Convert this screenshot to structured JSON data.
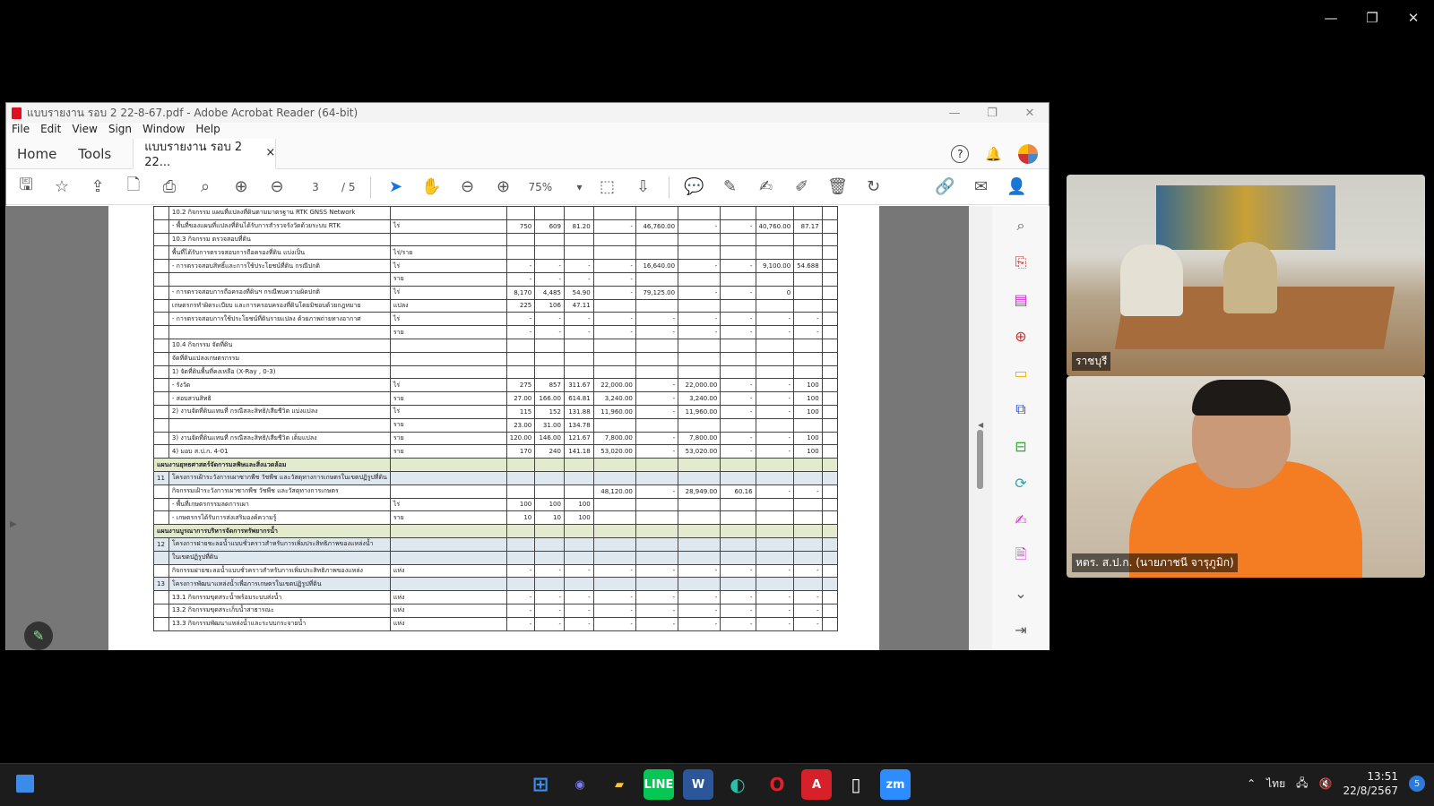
{
  "window": {
    "title": "แบบรายงาน รอบ 2 22-8-67.pdf - Adobe Acrobat Reader (64-bit)",
    "menu": [
      "File",
      "Edit",
      "View",
      "Sign",
      "Window",
      "Help"
    ],
    "tabs": {
      "home": "Home",
      "tools": "Tools",
      "doc": "แบบรายงาน รอบ 2 22...",
      "close": "×"
    }
  },
  "toolbar": {
    "page_current": "3",
    "page_total": "/ 5",
    "zoom": "75%"
  },
  "sheet": {
    "rows": [
      {
        "c0": "",
        "c1": "10.2  กิจกรรม แผนที่แปลงที่ดินตามมาตรฐาน RTK GNSS Network",
        "c2": "",
        "v": [
          "",
          "",
          "",
          "",
          "",
          "",
          "",
          "",
          "",
          ""
        ],
        "cls": ""
      },
      {
        "c0": "",
        "c1": "   - พื้นที่ของแผนที่แปลงที่ดินได้รับการสำรวจรังวัดด้วยระบบ RTK",
        "c2": "ไร่",
        "v": [
          "750",
          "609",
          "81.20",
          "-",
          "46,760.00",
          "-",
          "-",
          "40,760.00",
          "87.17",
          ""
        ],
        "cls": ""
      },
      {
        "c0": "",
        "c1": "10.3  กิจกรรม ตรวจสอบที่ดิน",
        "c2": "",
        "v": [
          "",
          "",
          "",
          "",
          "",
          "",
          "",
          "",
          "",
          ""
        ],
        "cls": ""
      },
      {
        "c0": "",
        "c1": "   พื้นที่ได้รับการตรวจสอบการถือครองที่ดิน แบ่งเป็น",
        "c2": "ไร่/ราย",
        "v": [
          "",
          "",
          "",
          "",
          "",
          "",
          "",
          "",
          "",
          ""
        ],
        "cls": ""
      },
      {
        "c0": "",
        "c1": "   - การตรวจสอบสิทธิ์และการใช้ประโยชน์ที่ดิน กรณีปกติ",
        "c2": "ไร่",
        "v": [
          "-",
          "-",
          "-",
          "-",
          "16,640.00",
          "-",
          "-",
          "9,100.00",
          "54.688",
          ""
        ],
        "cls": ""
      },
      {
        "c0": "",
        "c1": "",
        "c2": "ราย",
        "v": [
          "-",
          "-",
          "-",
          "-",
          "",
          "",
          "",
          "",
          "",
          ""
        ],
        "cls": ""
      },
      {
        "c0": "",
        "c1": "   - การตรวจสอบการถือครองที่ดินฯ กรณีพบความผิดปกติ",
        "c2": "ไร่",
        "v": [
          "8,170",
          "4,485",
          "54.90",
          "-",
          "79,125.00",
          "-",
          "-",
          "0",
          "",
          ""
        ],
        "cls": ""
      },
      {
        "c0": "",
        "c1": "     เกษตรกรทำผิดระเบียบ และการครอบครองที่ดินโดยมิชอบด้วยกฎหมาย",
        "c2": "แปลง",
        "v": [
          "225",
          "106",
          "47.11",
          "",
          "",
          "",
          "",
          "",
          "",
          ""
        ],
        "cls": ""
      },
      {
        "c0": "",
        "c1": "   - การตรวจสอบการใช้ประโยชน์ที่ดินรายแปลง ด้วยภาพถ่ายทางอากาศ",
        "c2": "ไร่",
        "v": [
          "-",
          "-",
          "-",
          "-",
          "-",
          "-",
          "-",
          "-",
          "-",
          ""
        ],
        "cls": ""
      },
      {
        "c0": "",
        "c1": "",
        "c2": "ราย",
        "v": [
          "-",
          "-",
          "-",
          "-",
          "-",
          "-",
          "-",
          "-",
          "-",
          ""
        ],
        "cls": ""
      },
      {
        "c0": "",
        "c1": "10.4  กิจกรรม จัดที่ดิน",
        "c2": "",
        "v": [
          "",
          "",
          "",
          "",
          "",
          "",
          "",
          "",
          "",
          ""
        ],
        "cls": ""
      },
      {
        "c0": "",
        "c1": "   จัดที่ดินแปลงเกษตรกรรม",
        "c2": "",
        "v": [
          "",
          "",
          "",
          "",
          "",
          "",
          "",
          "",
          "",
          ""
        ],
        "cls": ""
      },
      {
        "c0": "",
        "c1": "   1) จัดที่ดินพื้นที่คงเหลือ (X-Ray , 0-3)",
        "c2": "",
        "v": [
          "",
          "",
          "",
          "",
          "",
          "",
          "",
          "",
          "",
          ""
        ],
        "cls": ""
      },
      {
        "c0": "",
        "c1": "        - รังวัด",
        "c2": "ไร่",
        "v": [
          "275",
          "857",
          "311.67",
          "22,000.00",
          "-",
          "22,000.00",
          "-",
          "-",
          "100",
          ""
        ],
        "cls": ""
      },
      {
        "c0": "",
        "c1": "        - สอบสวนสิทธิ",
        "c2": "ราย",
        "v": [
          "27.00",
          "166.00",
          "614.81",
          "3,240.00",
          "-",
          "3,240.00",
          "-",
          "-",
          "100",
          ""
        ],
        "cls": ""
      },
      {
        "c0": "",
        "c1": "   2) งานจัดที่ดินแทนที่ กรณีสละสิทธิ/เสียชีวิต แบ่งแปลง",
        "c2": "ไร่",
        "v": [
          "115",
          "152",
          "131.88",
          "11,960.00",
          "-",
          "11,960.00",
          "-",
          "-",
          "100",
          ""
        ],
        "cls": ""
      },
      {
        "c0": "",
        "c1": "",
        "c2": "ราย",
        "v": [
          "23.00",
          "31.00",
          "134.78",
          "",
          "",
          "",
          "",
          "",
          "",
          ""
        ],
        "cls": ""
      },
      {
        "c0": "",
        "c1": "   3) งานจัดที่ดินแทนที่ กรณีสละสิทธิ/เสียชีวิต เต็มแปลง",
        "c2": "ราย",
        "v": [
          "120.00",
          "146.00",
          "121.67",
          "7,800.00",
          "-",
          "7,800.00",
          "-",
          "-",
          "100",
          ""
        ],
        "cls": ""
      },
      {
        "c0": "",
        "c1": "   4) มอบ ส.ป.ก. 4-01",
        "c2": "ราย",
        "v": [
          "170",
          "240",
          "141.18",
          "53,020.00",
          "-",
          "53,020.00",
          "-",
          "-",
          "100",
          ""
        ],
        "cls": ""
      },
      {
        "c0": "แผนงานยุทธศาสตร์จัดการมลพิษและสิ่งแวดล้อม",
        "c1": "",
        "c2": "",
        "v": [
          "",
          "",
          "",
          "",
          "",
          "",
          "",
          "",
          "",
          ""
        ],
        "cls": "plan"
      },
      {
        "c0": "11",
        "c1": "โครงการเฝ้าระวังการเผาซากพืช วัชพืช และวัสดุทางการเกษตรในเขตปฏิรูปที่ดิน",
        "c2": "",
        "v": [
          "",
          "",
          "",
          "",
          "",
          "",
          "",
          "",
          "",
          ""
        ],
        "cls": "hl"
      },
      {
        "c0": "",
        "c1": "   กิจกรรมเฝ้าระวังการเผาซากพืช วัชพืช และวัสดุทางการเกษตร",
        "c2": "",
        "v": [
          "",
          "",
          "",
          "48,120.00",
          "-",
          "28,949.00",
          "60.16",
          "-",
          "-",
          ""
        ],
        "cls": ""
      },
      {
        "c0": "",
        "c1": "   - พื้นที่เกษตรกรรมลดการเผา",
        "c2": "ไร่",
        "v": [
          "100",
          "100",
          "100",
          "",
          "",
          "",
          "",
          "",
          "",
          ""
        ],
        "cls": ""
      },
      {
        "c0": "",
        "c1": "   - เกษตรกรได้รับการส่งเสริมองค์ความรู้",
        "c2": "ราย",
        "v": [
          "10",
          "10",
          "100",
          "",
          "",
          "",
          "",
          "",
          "",
          ""
        ],
        "cls": ""
      },
      {
        "c0": "แผนงานบูรณาการบริหารจัดการทรัพยากรน้ำ",
        "c1": "",
        "c2": "",
        "v": [
          "",
          "",
          "",
          "",
          "",
          "",
          "",
          "",
          "",
          ""
        ],
        "cls": "plan"
      },
      {
        "c0": "12",
        "c1": "โครงการฝายชะลอน้ำแบบชั่วคราวสำหรับการเพิ่มประสิทธิภาพของแหล่งน้ำ",
        "c2": "",
        "v": [
          "",
          "",
          "",
          "",
          "",
          "",
          "",
          "",
          "",
          ""
        ],
        "cls": "hl"
      },
      {
        "c0": "",
        "c1": "ในเขตปฏิรูปที่ดิน",
        "c2": "",
        "v": [
          "",
          "",
          "",
          "",
          "",
          "",
          "",
          "",
          "",
          ""
        ],
        "cls": "hl"
      },
      {
        "c0": "",
        "c1": "   กิจกรรมฝายชะลอน้ำแบบชั่วคราวสำหรับการเพิ่มประสิทธิภาพของแหล่ง",
        "c2": "แห่ง",
        "v": [
          "-",
          "-",
          "-",
          "-",
          "-",
          "-",
          "-",
          "-",
          "-",
          ""
        ],
        "cls": ""
      },
      {
        "c0": "13",
        "c1": "โครงการพัฒนาแหล่งน้ำเพื่อการเกษตรในเขตปฏิรูปที่ดิน",
        "c2": "",
        "v": [
          "",
          "",
          "",
          "",
          "",
          "",
          "",
          "",
          "",
          ""
        ],
        "cls": "hl"
      },
      {
        "c0": "",
        "c1": "   13.1 กิจกรรมขุดสระน้ำพร้อมระบบส่งน้ำ",
        "c2": "แห่ง",
        "v": [
          "-",
          "-",
          "-",
          "-",
          "-",
          "-",
          "-",
          "-",
          "-",
          ""
        ],
        "cls": ""
      },
      {
        "c0": "",
        "c1": "   13.2 กิจกรรมขุดสระเก็บน้ำสาธารณะ",
        "c2": "แห่ง",
        "v": [
          "-",
          "-",
          "-",
          "-",
          "-",
          "-",
          "-",
          "-",
          "-",
          ""
        ],
        "cls": ""
      },
      {
        "c0": "",
        "c1": "   13.3 กิจกรรมพัฒนาแหล่งน้ำและระบบกระจายน้ำ",
        "c2": "แห่ง",
        "v": [
          "-",
          "-",
          "-",
          "-",
          "-",
          "-",
          "-",
          "-",
          "-",
          ""
        ],
        "cls": ""
      }
    ]
  },
  "video": {
    "tile1_name": "ราชบุรี",
    "tile2_name": "หตร. ส.ป.ก. (นายภาชนี จารุภูมิก)"
  },
  "taskbar": {
    "apps": [
      "windows",
      "zoom-meet",
      "explorer",
      "line",
      "word",
      "edge",
      "opera",
      "acrobat",
      "notepad",
      "zoom"
    ],
    "lang": "ไทย",
    "time": "13:51",
    "date": "22/8/2567",
    "badge": "5"
  }
}
